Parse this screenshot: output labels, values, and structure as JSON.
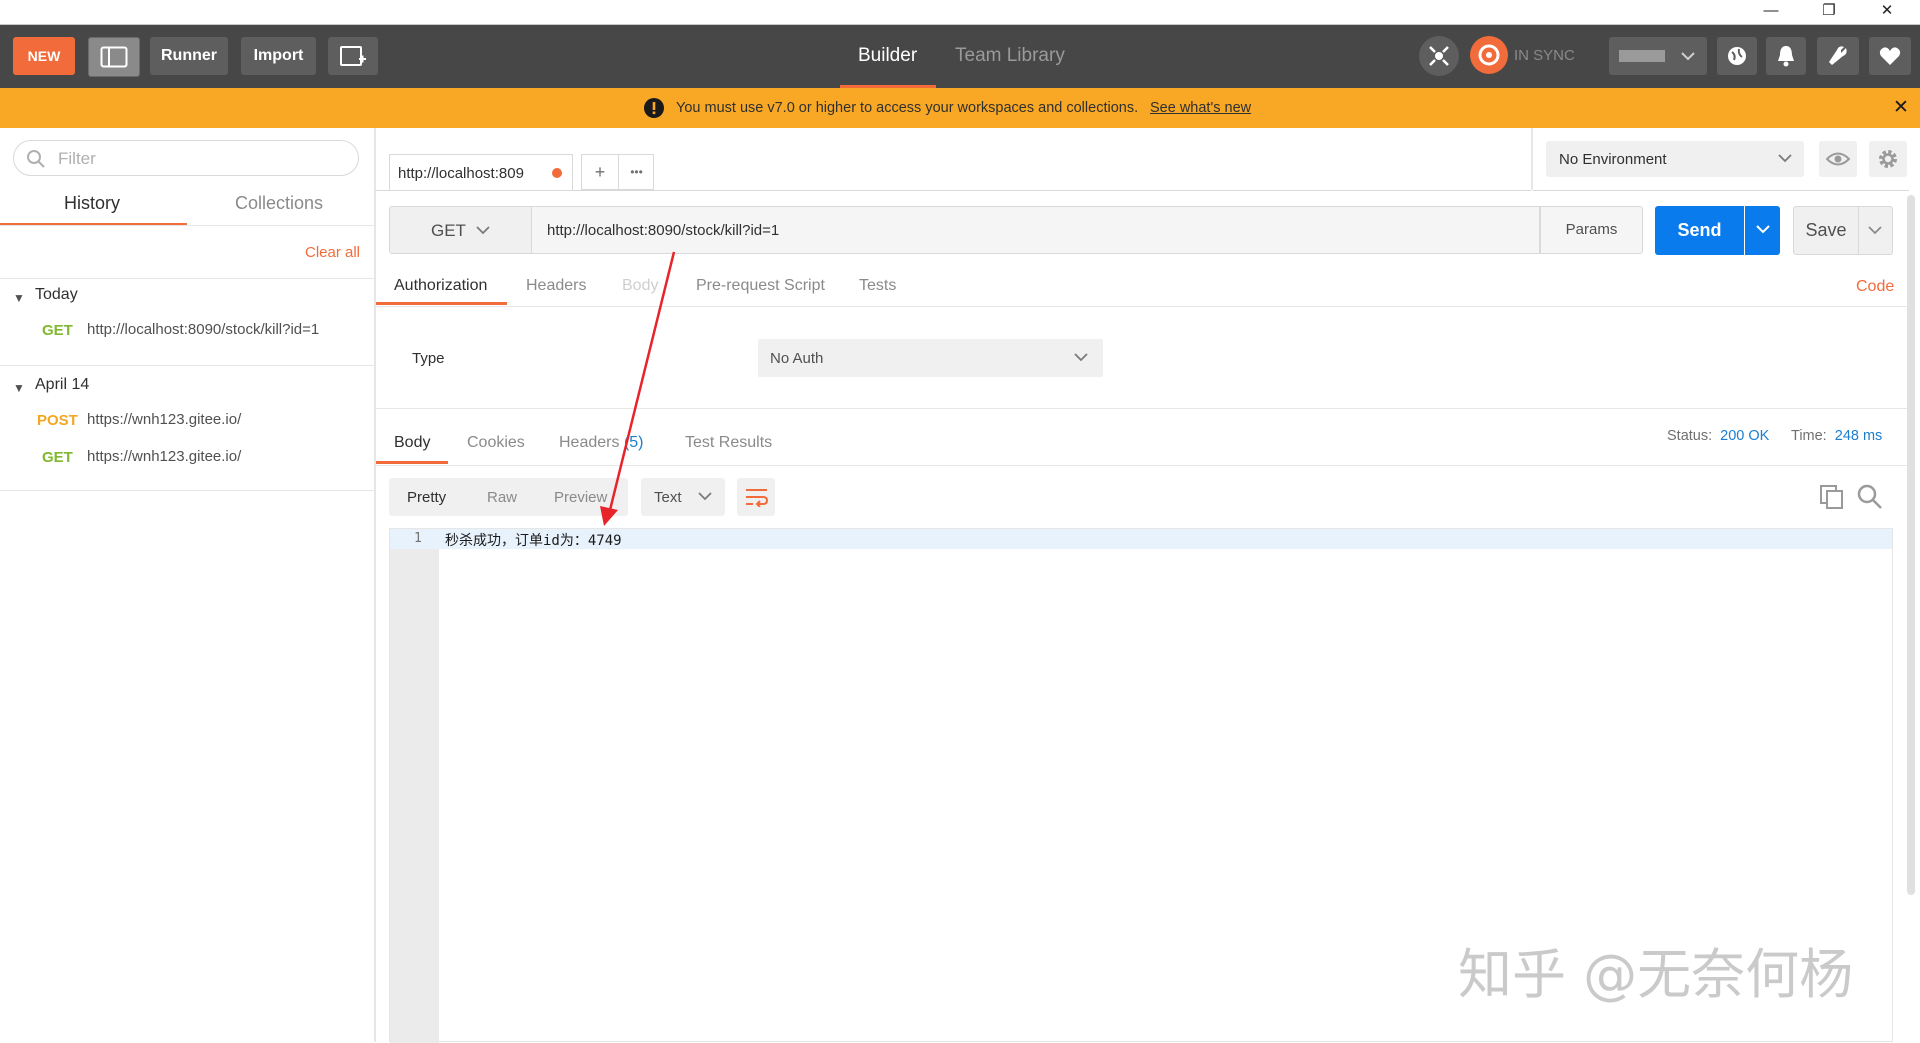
{
  "window": {
    "minimize": "—",
    "restore": "❐",
    "close": "✕"
  },
  "header": {
    "new_label": "NEW",
    "runner_label": "Runner",
    "import_label": "Import",
    "tab_builder": "Builder",
    "tab_team_library": "Team Library",
    "sync_label": "IN SYNC"
  },
  "banner": {
    "message": "You must use v7.0 or higher to access your workspaces and collections.",
    "link": "See what's new",
    "close": "✕"
  },
  "sidebar": {
    "filter_placeholder": "Filter",
    "tab_history": "History",
    "tab_collections": "Collections",
    "clear_all": "Clear all",
    "groups": [
      {
        "label": "Today",
        "items": [
          {
            "method": "GET",
            "url": "http://localhost:8090/stock/kill?id=1"
          }
        ]
      },
      {
        "label": "April 14",
        "items": [
          {
            "method": "POST",
            "url": "https://wnh123.gitee.io/"
          },
          {
            "method": "GET",
            "url": "https://wnh123.gitee.io/"
          }
        ]
      }
    ]
  },
  "request_tab": {
    "title": "http://localhost:809",
    "add": "+",
    "more": "•••"
  },
  "environment": {
    "selected": "No Environment"
  },
  "request": {
    "method": "GET",
    "url": "http://localhost:8090/stock/kill?id=1",
    "params_label": "Params",
    "send_label": "Send",
    "save_label": "Save"
  },
  "request_tabs": {
    "authorization": "Authorization",
    "headers": "Headers",
    "body": "Body",
    "prerequest": "Pre-request Script",
    "tests": "Tests",
    "code": "Code"
  },
  "auth": {
    "type_label": "Type",
    "type_value": "No Auth"
  },
  "response_tabs": {
    "body": "Body",
    "cookies": "Cookies",
    "headers": "Headers",
    "headers_count": "(5)",
    "test_results": "Test Results",
    "status_label": "Status:",
    "status_value": "200 OK",
    "time_label": "Time:",
    "time_value": "248 ms"
  },
  "response_view": {
    "pretty": "Pretty",
    "raw": "Raw",
    "preview": "Preview",
    "format": "Text"
  },
  "response_body": {
    "line_number": "1",
    "line_text": "秒杀成功，订单id为：4749"
  },
  "watermark": "知乎 @无奈何杨",
  "colors": {
    "header_bg": "#474747",
    "accent_orange": "#f26b3a",
    "banner_bg": "#f8a825",
    "send_blue": "#097bed",
    "get_green": "#80b82f",
    "post_orange": "#f5a623",
    "status_blue": "#1b7ecf"
  }
}
